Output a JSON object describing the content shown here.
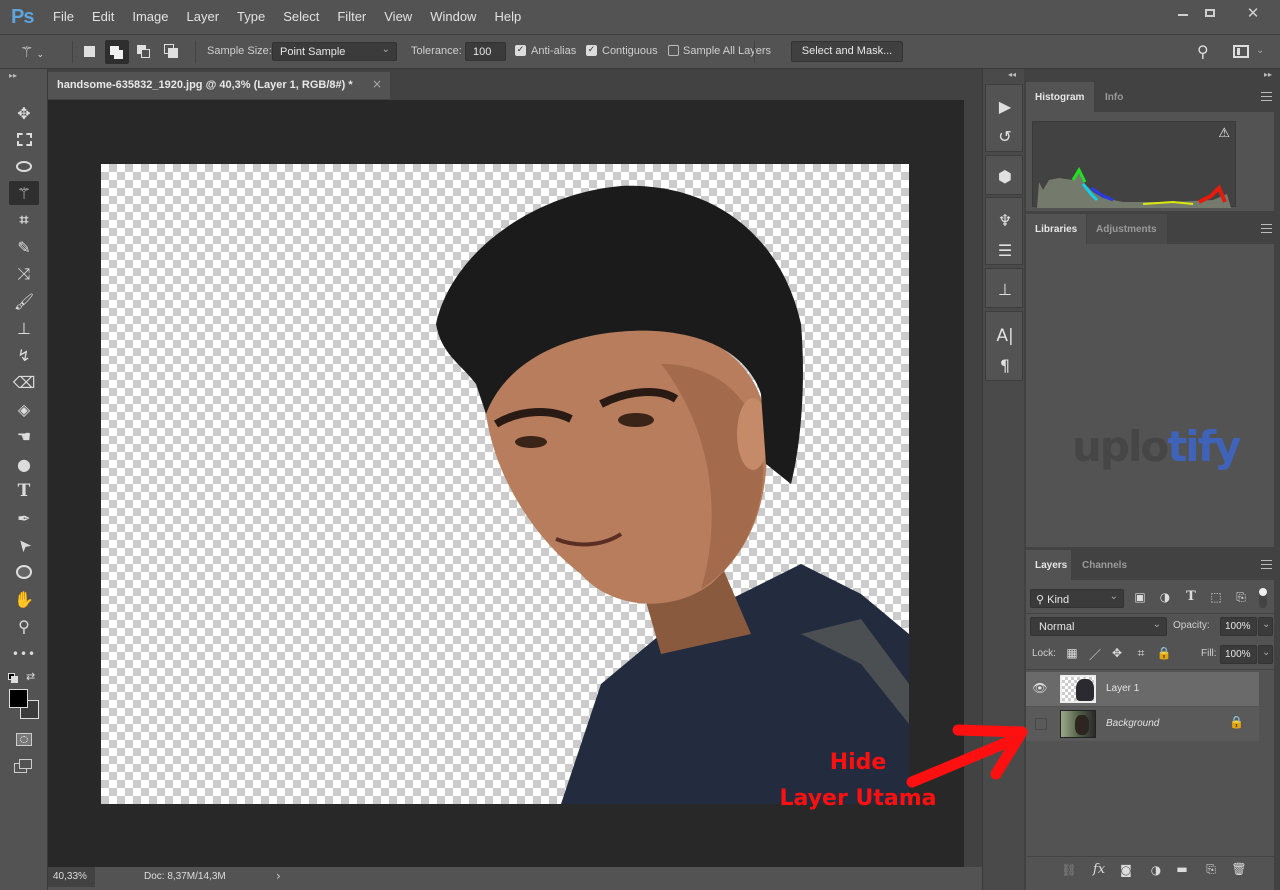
{
  "app": {
    "logo": "Ps",
    "menu": [
      "File",
      "Edit",
      "Image",
      "Layer",
      "Type",
      "Select",
      "Filter",
      "View",
      "Window",
      "Help"
    ],
    "window_controls": {
      "minimize": "minimize-icon",
      "maximize": "maximize-icon",
      "close": "close-icon"
    }
  },
  "options_bar": {
    "active_tool_icon": "magic-wand-icon",
    "selection_modes": [
      "new-selection",
      "add-to-selection",
      "subtract-from-selection",
      "intersect-selection"
    ],
    "active_mode": "add-to-selection",
    "sample_size_label": "Sample Size:",
    "sample_size_value": "Point Sample",
    "tolerance_label": "Tolerance:",
    "tolerance_value": "100",
    "anti_alias": {
      "label": "Anti-alias",
      "checked": true
    },
    "contiguous": {
      "label": "Contiguous",
      "checked": true
    },
    "sample_all_layers": {
      "label": "Sample All Layers",
      "checked": false
    },
    "select_and_mask_label": "Select and Mask..."
  },
  "document": {
    "tab_title": "handsome-635832_1920.jpg @ 40,3% (Layer 1, RGB/8#) *",
    "close_glyph": "×"
  },
  "status_bar": {
    "zoom": "40,33%",
    "doc_size": "Doc: 8,37M/14,3M",
    "arrow": "›"
  },
  "tools": [
    {
      "name": "move-tool",
      "glyph": "✥"
    },
    {
      "name": "rectangular-marquee-tool",
      "glyph": "⬚"
    },
    {
      "name": "lasso-tool",
      "glyph": "◯"
    },
    {
      "name": "magic-wand-tool",
      "glyph": "✦",
      "selected": true
    },
    {
      "name": "crop-tool",
      "glyph": "⌗"
    },
    {
      "name": "eyedropper-tool",
      "glyph": "⚲"
    },
    {
      "name": "healing-brush-tool",
      "glyph": "✕"
    },
    {
      "name": "brush-tool",
      "glyph": "／"
    },
    {
      "name": "clone-stamp-tool",
      "glyph": "⊥"
    },
    {
      "name": "history-brush-tool",
      "glyph": "↯"
    },
    {
      "name": "eraser-tool",
      "glyph": "⌫"
    },
    {
      "name": "paint-bucket-tool",
      "glyph": "◈"
    },
    {
      "name": "smudge-tool",
      "glyph": "☚"
    },
    {
      "name": "dodge-tool",
      "glyph": "●"
    },
    {
      "name": "type-tool",
      "glyph": "T"
    },
    {
      "name": "pen-tool",
      "glyph": "✒"
    },
    {
      "name": "path-selection-tool",
      "glyph": "➤"
    },
    {
      "name": "ellipse-tool",
      "glyph": "◯"
    },
    {
      "name": "hand-tool",
      "glyph": "✋"
    },
    {
      "name": "zoom-tool",
      "glyph": "⚲"
    },
    {
      "name": "edit-toolbar",
      "glyph": "•••"
    }
  ],
  "colors": {
    "foreground": "#000000",
    "background": "#3c3c3c",
    "annotation": "#ff1010",
    "brand_blue": "#3f63b8"
  },
  "dock": [
    {
      "name": "actions-icon",
      "glyph": "▶"
    },
    {
      "name": "history-icon",
      "glyph": "↺"
    },
    {
      "name": "3d-icon",
      "glyph": "⬢"
    },
    {
      "name": "brushes-icon",
      "glyph": "♆"
    },
    {
      "name": "brush-settings-icon",
      "glyph": "☰"
    },
    {
      "name": "clone-source-icon",
      "glyph": "⊥"
    },
    {
      "name": "character-icon",
      "glyph": "A|"
    },
    {
      "name": "paragraph-icon",
      "glyph": "¶"
    }
  ],
  "panels": {
    "histogram": {
      "tabs": [
        "Histogram",
        "Info"
      ],
      "active": "Histogram",
      "warning": "⚠"
    },
    "libraries": {
      "tabs": [
        "Libraries",
        "Adjustments"
      ],
      "active": "Libraries",
      "watermark_a": "uplo",
      "watermark_b": "tify"
    },
    "layers": {
      "tabs": [
        "Layers",
        "Channels"
      ],
      "active": "Layers",
      "filter_kind": "Kind",
      "blend_mode": "Normal",
      "opacity_label": "Opacity:",
      "opacity_value": "100%",
      "lock_label": "Lock:",
      "fill_label": "Fill:",
      "fill_value": "100%",
      "rows": [
        {
          "name": "Layer 1",
          "visible": true,
          "selected": true,
          "locked": false
        },
        {
          "name": "Background",
          "visible": false,
          "selected": false,
          "locked": true
        }
      ],
      "footer_icons": [
        "link-layers-icon",
        "fx-icon",
        "add-mask-icon",
        "adjustment-layer-icon",
        "group-icon",
        "new-layer-icon",
        "delete-icon"
      ]
    }
  },
  "annotation": {
    "line1": "Hide",
    "line2": "Layer Utama"
  }
}
